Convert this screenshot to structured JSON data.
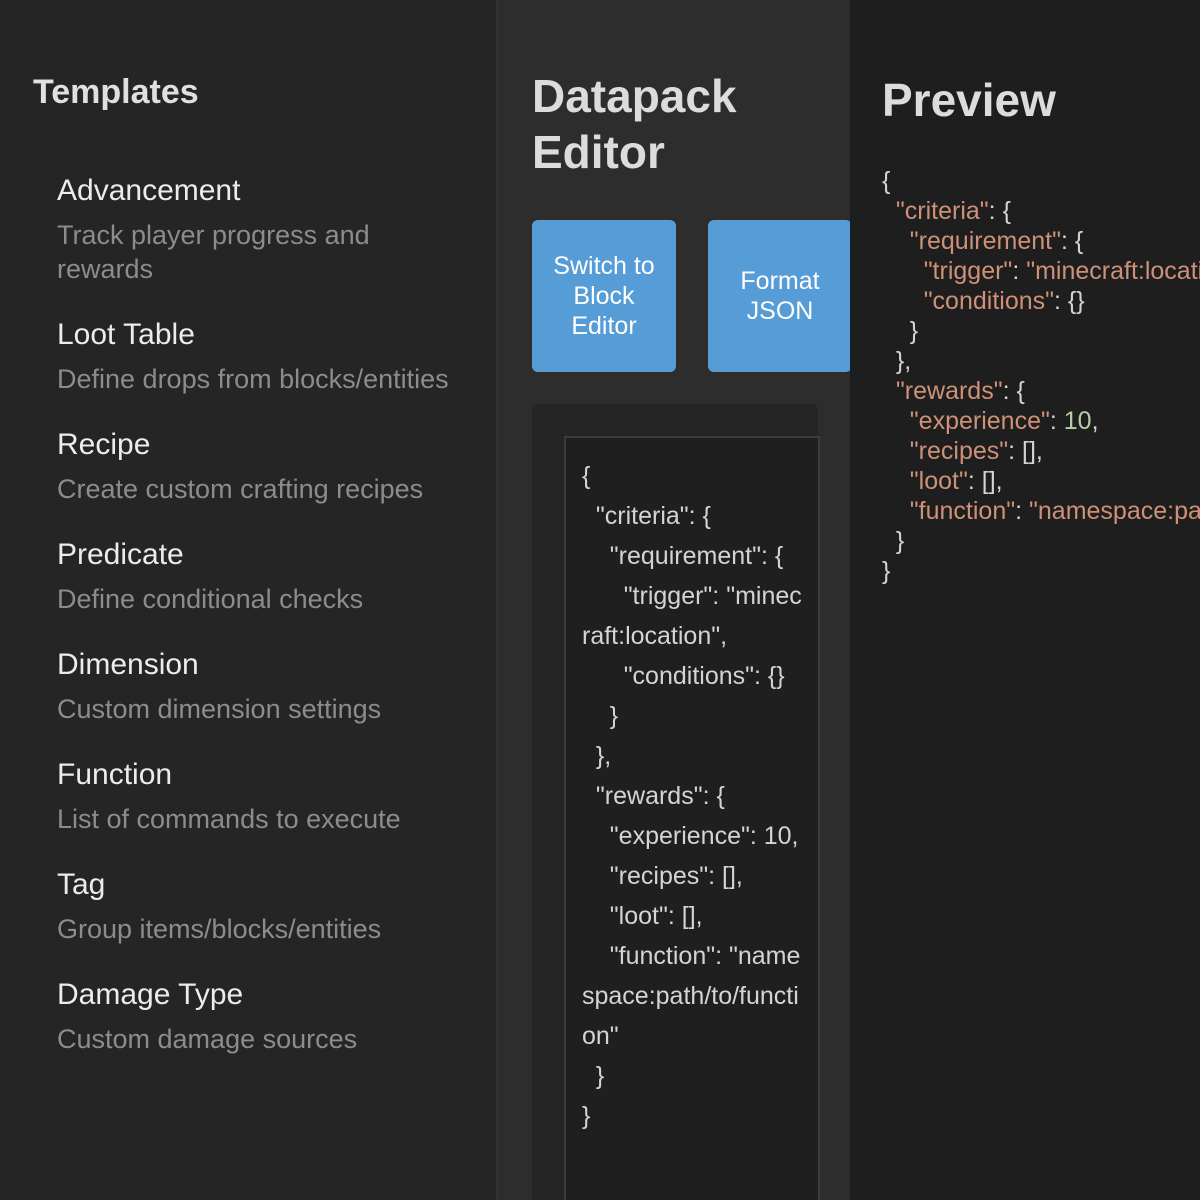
{
  "sidebar": {
    "title": "Templates",
    "items": [
      {
        "name": "Advancement",
        "description": "Track player progress and rewards"
      },
      {
        "name": "Loot Table",
        "description": "Define drops from blocks/entities"
      },
      {
        "name": "Recipe",
        "description": "Create custom crafting recipes"
      },
      {
        "name": "Predicate",
        "description": "Define conditional checks"
      },
      {
        "name": "Dimension",
        "description": "Custom dimension settings"
      },
      {
        "name": "Function",
        "description": "List of commands to execute"
      },
      {
        "name": "Tag",
        "description": "Group items/blocks/entities"
      },
      {
        "name": "Damage Type",
        "description": "Custom damage sources"
      }
    ]
  },
  "editor": {
    "title": "Datapack Editor",
    "buttons": {
      "switch_label": "Switch to Block Editor",
      "format_label": "Format JSON"
    },
    "code": "{\n  \"criteria\": {\n    \"requirement\": {\n      \"trigger\": \"minecraft:location\",\n      \"conditions\": {}\n    }\n  },\n  \"rewards\": {\n    \"experience\": 10,\n    \"recipes\": [],\n    \"loot\": [],\n    \"function\": \"namespace:path/to/function\"\n  }\n}"
  },
  "preview": {
    "title": "Preview",
    "lines": [
      {
        "indent": "",
        "key": "",
        "value": "",
        "punct": "{"
      },
      {
        "indent": "  ",
        "key": "\"criteria\"",
        "value": "",
        "punct": ": {"
      },
      {
        "indent": "    ",
        "key": "\"requirement\"",
        "value": "",
        "punct": ": {"
      },
      {
        "indent": "      ",
        "key": "\"trigger\"",
        "punct": ": ",
        "value": "\"minecraft:location\"",
        "value_type": "string",
        "tail": ","
      },
      {
        "indent": "      ",
        "key": "\"conditions\"",
        "value": "",
        "punct": ": {}"
      },
      {
        "indent": "    ",
        "key": "",
        "value": "",
        "punct": "}"
      },
      {
        "indent": "  ",
        "key": "",
        "value": "",
        "punct": "},"
      },
      {
        "indent": "  ",
        "key": "\"rewards\"",
        "value": "",
        "punct": ": {"
      },
      {
        "indent": "    ",
        "key": "\"experience\"",
        "punct": ": ",
        "value": "10",
        "value_type": "number",
        "tail": ","
      },
      {
        "indent": "    ",
        "key": "\"recipes\"",
        "value": "",
        "punct": ": [],"
      },
      {
        "indent": "    ",
        "key": "\"loot\"",
        "value": "",
        "punct": ": [],"
      },
      {
        "indent": "    ",
        "key": "\"function\"",
        "punct": ": ",
        "value": "\"namespace:path/to/function\"",
        "value_type": "string",
        "tail": ""
      },
      {
        "indent": "  ",
        "key": "",
        "value": "",
        "punct": "}"
      },
      {
        "indent": "",
        "key": "",
        "value": "",
        "punct": "}"
      }
    ]
  },
  "colors": {
    "accent": "#569cd6",
    "json_key": "#ce9178",
    "json_string": "#ce9178",
    "json_number": "#b5cea8"
  }
}
